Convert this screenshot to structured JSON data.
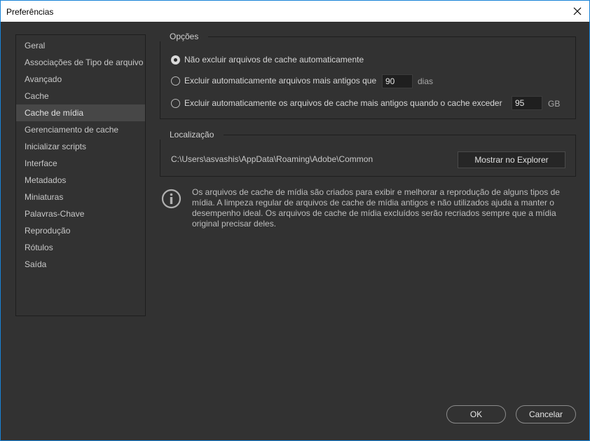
{
  "window": {
    "title": "Preferências"
  },
  "sidebar": {
    "items": [
      {
        "label": "Geral"
      },
      {
        "label": "Associações de Tipo de arquivo"
      },
      {
        "label": "Avançado"
      },
      {
        "label": "Cache"
      },
      {
        "label": "Cache de mídia",
        "selected": true
      },
      {
        "label": "Gerenciamento de cache"
      },
      {
        "label": "Inicializar scripts"
      },
      {
        "label": "Interface"
      },
      {
        "label": "Metadados"
      },
      {
        "label": "Miniaturas"
      },
      {
        "label": "Palavras-Chave"
      },
      {
        "label": "Reprodução"
      },
      {
        "label": "Rótulos"
      },
      {
        "label": "Saída"
      }
    ]
  },
  "options": {
    "label": "Opções",
    "radio_no_delete": "Não excluir arquivos de cache automaticamente",
    "radio_older_than": "Excluir automaticamente arquivos mais antigos que",
    "older_than_value": "90",
    "older_than_unit": "dias",
    "radio_exceed": "Excluir automaticamente os arquivos de cache mais antigos quando o cache exceder",
    "exceed_value": "95",
    "exceed_unit": "GB",
    "selected": "no_delete"
  },
  "location": {
    "label": "Localização",
    "path": "C:\\Users\\asvashis\\AppData\\Roaming\\Adobe\\Common",
    "show_button": "Mostrar no Explorer"
  },
  "info": {
    "text": "Os arquivos de cache de mídia são criados para exibir e melhorar a reprodução de alguns tipos de mídia. A limpeza regular de arquivos de cache de mídia antigos e não utilizados ajuda a manter o desempenho ideal. Os arquivos de cache de mídia excluídos serão recriados sempre que a mídia original precisar deles."
  },
  "footer": {
    "ok": "OK",
    "cancel": "Cancelar"
  },
  "colors": {
    "window_bg": "#323232",
    "accent_border": "#1883d7"
  }
}
